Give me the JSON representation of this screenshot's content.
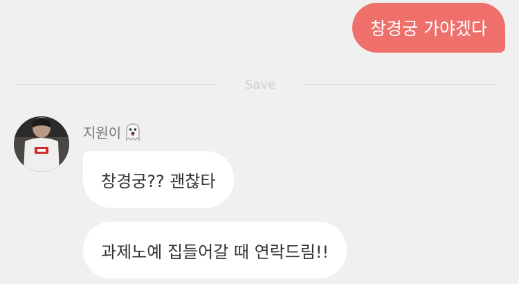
{
  "outgoing": {
    "message": "창경궁 가야겠다"
  },
  "divider": {
    "label": "Save"
  },
  "incoming": {
    "sender_name": "지원이",
    "sender_icon": "ghost-icon",
    "messages": [
      "창경궁?? 괜찮타",
      "과제노예 집들어갈 때 연락드림!!"
    ]
  },
  "colors": {
    "background": "#f0f0f0",
    "outgoing_bubble": "#ef6f6a",
    "incoming_bubble": "#ffffff",
    "divider_line": "#d3d3d3"
  }
}
